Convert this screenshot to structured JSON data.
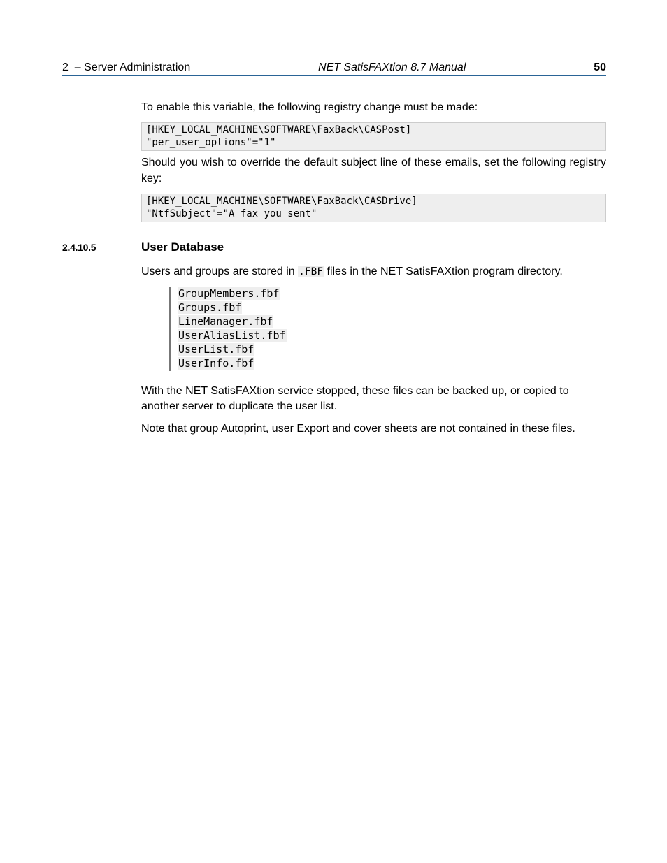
{
  "header": {
    "chapter_num": "2",
    "dash": "–",
    "chapter_title": "Server Administration",
    "doc_title": "NET SatisFAXtion 8.7 Manual",
    "page_number": "50"
  },
  "body": {
    "intro_para": "To enable this variable, the following registry change must be made:",
    "code1": "[HKEY_LOCAL_MACHINE\\SOFTWARE\\FaxBack\\CASPost]\n\"per_user_options\"=\"1\"",
    "override_para": "Should you wish to override the default subject line of these emails, set the fol­lowing registry key:",
    "code2": "[HKEY_LOCAL_MACHINE\\SOFTWARE\\FaxBack\\CASDrive]\n\"NtfSubject\"=\"A fax you sent\"",
    "section": {
      "number": "2.4.10.5",
      "title": "User Database"
    },
    "user_db_para_pre": "Users and groups are stored in ",
    "user_db_ext": ".FBF",
    "user_db_para_post": " files in the NET SatisFAXtion program di­rectory.",
    "files": [
      "GroupMembers.fbf",
      "Groups.fbf",
      "LineManager.fbf",
      "UserAliasList.fbf",
      "UserList.fbf",
      "UserInfo.fbf"
    ],
    "backup_para": "With the NET SatisFAXtion service stopped, these files can be backed up, or copied to another server to duplicate the user list.",
    "note_para": "Note that group Autoprint, user Export and cover sheets are not contained in these files."
  }
}
